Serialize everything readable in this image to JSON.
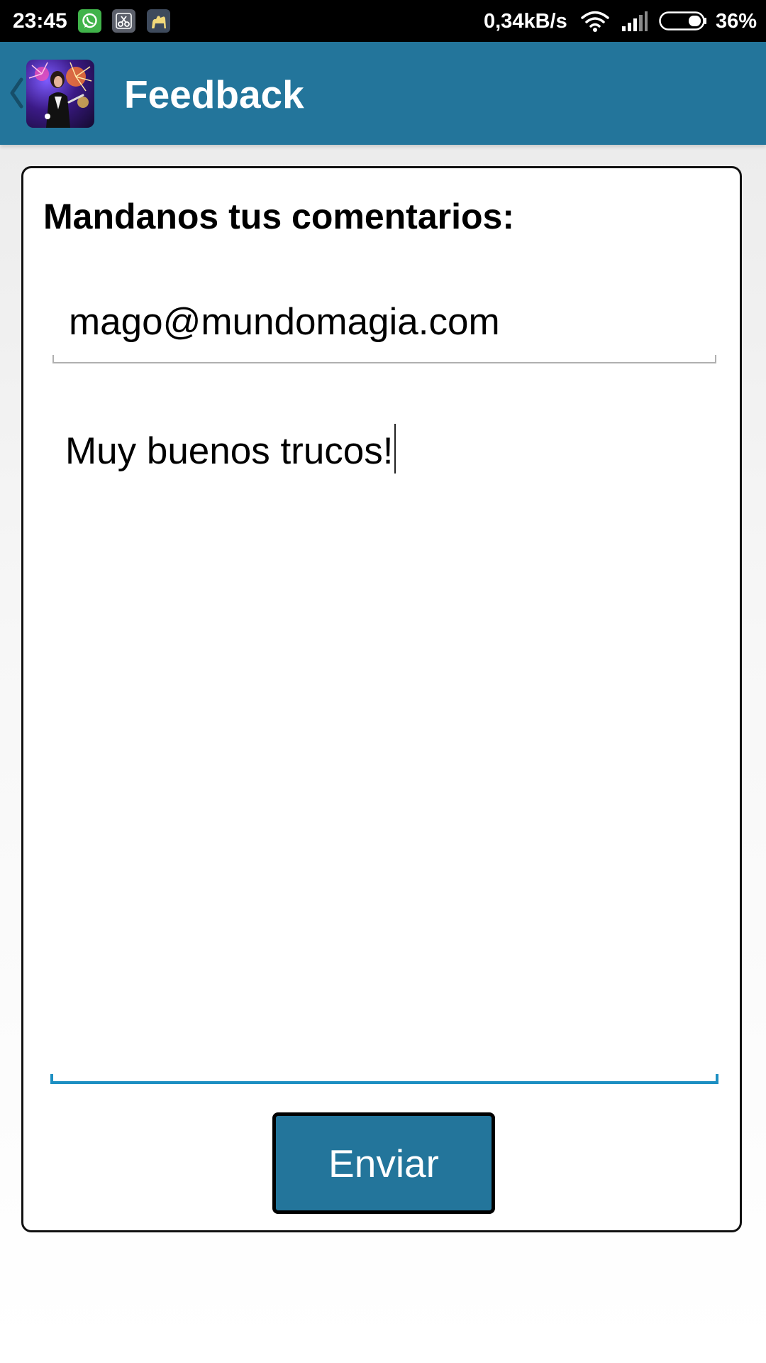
{
  "status_bar": {
    "time": "23:45",
    "network_speed": "0,34kB/s",
    "battery_percent": "36%",
    "battery_level": 0.36,
    "notification_icons": [
      "whatsapp-icon",
      "scissors-icon",
      "camel-icon"
    ],
    "system_icons": [
      "wifi-icon",
      "signal-icon",
      "battery-icon"
    ]
  },
  "app_bar": {
    "title": "Feedback",
    "back_icon": "chevron-left-icon",
    "logo": "magician-logo",
    "background_color": "#23759b"
  },
  "form": {
    "heading": "Mandanos tus comentarios:",
    "email_value": "mago@mundomagia.com",
    "message_value": "Muy buenos trucos!",
    "send_label": "Enviar",
    "accent_color": "#1c8fc2",
    "button_color": "#23759b"
  }
}
